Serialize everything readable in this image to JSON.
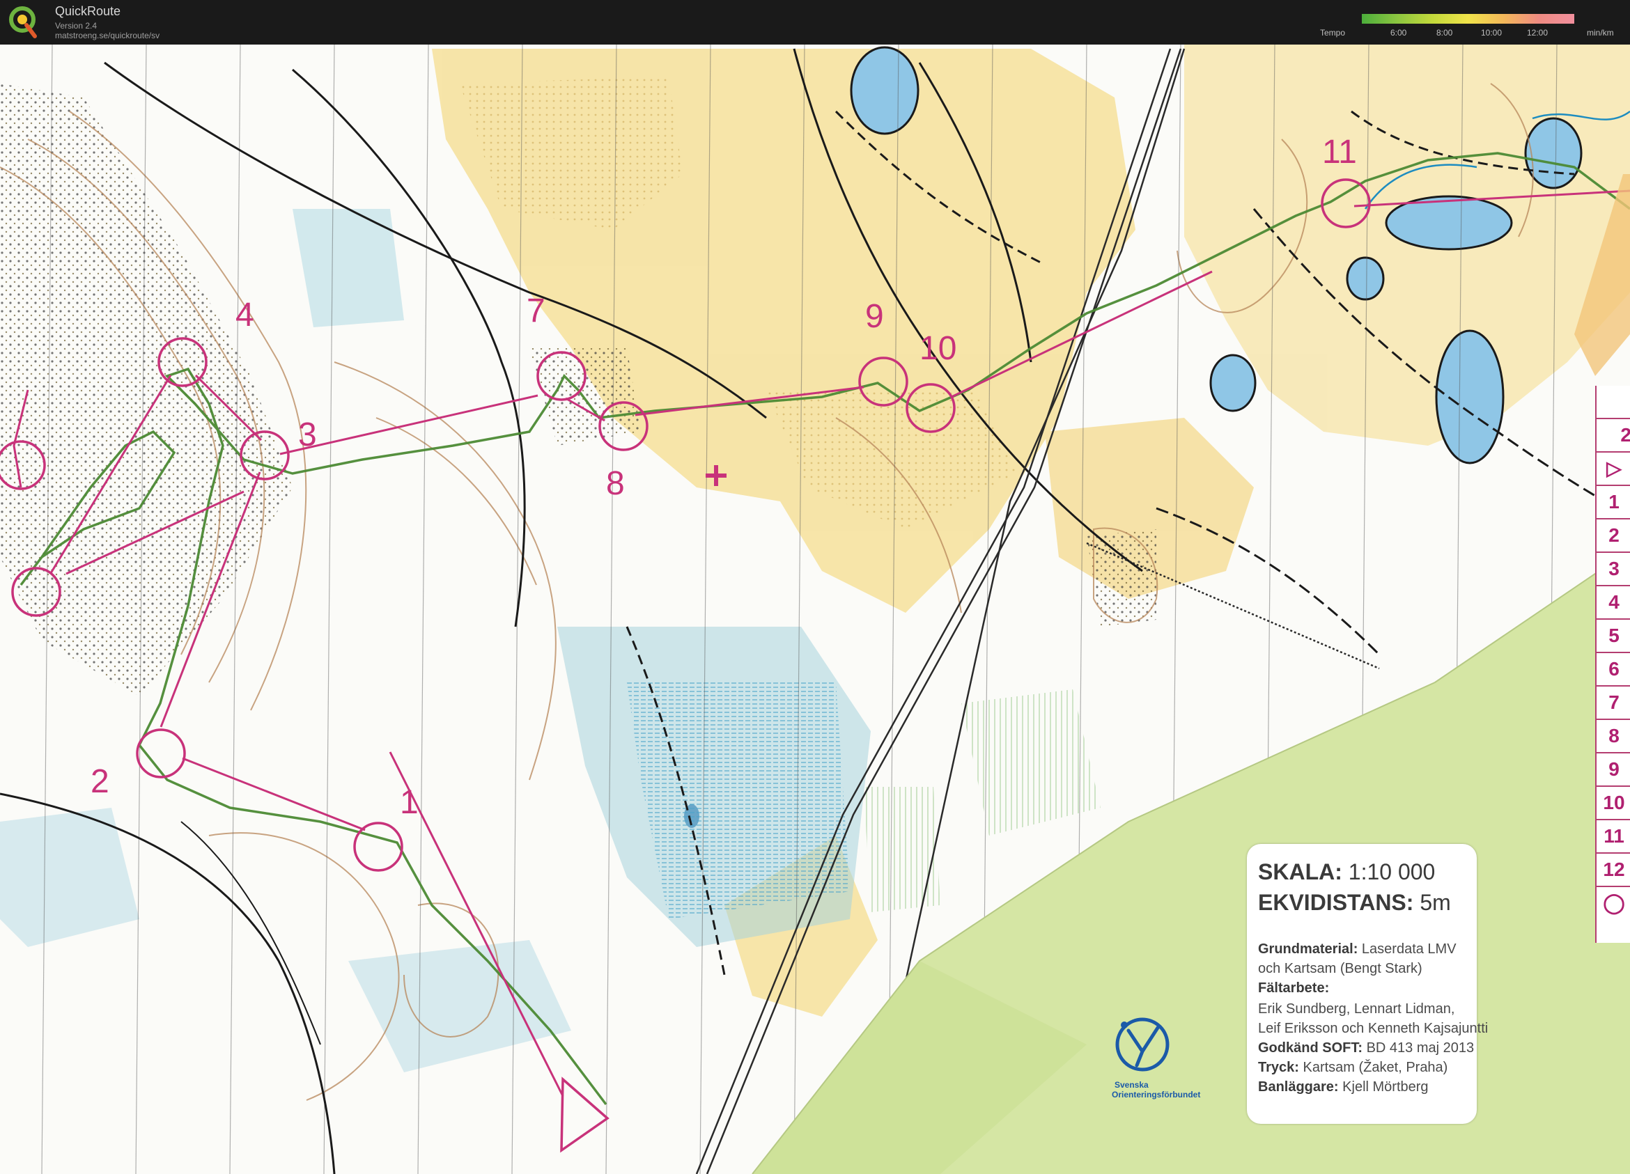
{
  "app": {
    "name": "QuickRoute",
    "version": "Version 2.4",
    "url": "matstroeng.se/quickroute/sv"
  },
  "tempo": {
    "label": "Tempo",
    "ticks": [
      "6:00",
      "8:00",
      "10:00",
      "12:00"
    ],
    "unit": "min/km"
  },
  "colors": {
    "course": "#c8327a",
    "route": "#4c8a34",
    "forest_yellow": "#f6e2a0",
    "marsh_blue": "#a7d3dd",
    "paper_green": "#d5e6a4"
  },
  "controls": [
    "1",
    "2",
    "3",
    "4",
    "5",
    "6",
    "7",
    "8",
    "9",
    "10",
    "11"
  ],
  "legend": {
    "scale_label": "SKALA:",
    "scale_value": "1:10 000",
    "contour_label": "EKVIDISTANS:",
    "contour_value": "5m",
    "base_label": "Grundmaterial:",
    "base_value1": "Laserdata LMV",
    "base_value2": "och Kartsam (Bengt Stark)",
    "field_label": "Fältarbete:",
    "field_value1": "Erik Sundberg, Lennart Lidman,",
    "field_value2": "Leif Eriksson och Kenneth Kajsajuntti",
    "approved_label": "Godkänd SOFT:",
    "approved_value": "BD 413 maj 2013",
    "print_label": "Tryck:",
    "print_value": "Kartsam (Žaket, Praha)",
    "setter_label": "Banläggare:",
    "setter_value": "Kjell Mörtberg",
    "federation_line1": "Svenska",
    "federation_line2": "Orienteringsförbundet"
  },
  "control_descriptions": {
    "partial": "2",
    "rows": [
      "1",
      "2",
      "3",
      "4",
      "5",
      "6",
      "7",
      "8",
      "9",
      "10",
      "11",
      "12"
    ]
  }
}
